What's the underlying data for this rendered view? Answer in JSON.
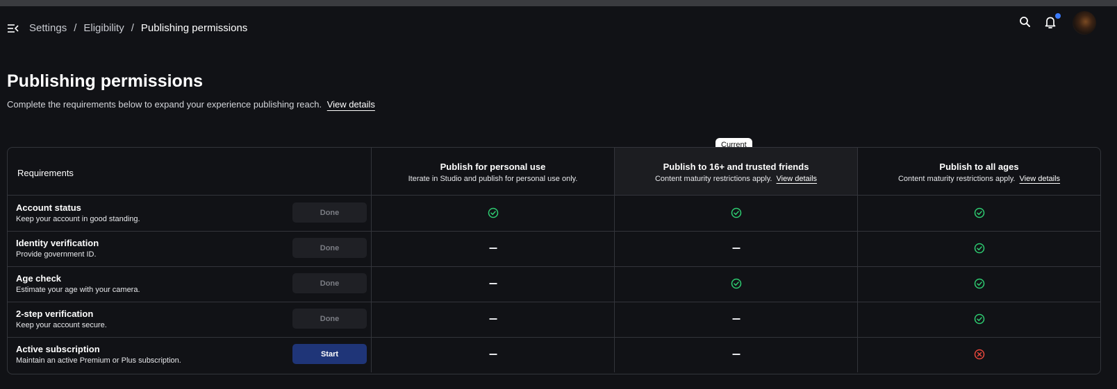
{
  "breadcrumbs": [
    "Settings",
    "Eligibility",
    "Publishing permissions"
  ],
  "page": {
    "title": "Publishing permissions",
    "subtitle": "Complete the requirements below to expand your experience publishing reach.",
    "subtitle_link": "View details"
  },
  "icons": {
    "menu": "menu-collapse-icon",
    "search": "search-icon",
    "bell": "bell-icon",
    "check": "check-circle-icon",
    "cross": "x-circle-icon",
    "dash": "dash-icon"
  },
  "colors": {
    "background": "#111216",
    "check": "#2ecc71",
    "cross": "#e8473b",
    "primary_button": "#1f3578",
    "notification_dot": "#3b7bff"
  },
  "table": {
    "requirements_header": "Requirements",
    "current_badge": "Current",
    "columns": [
      {
        "title": "Publish for personal use",
        "subtitle": "Iterate in Studio and publish for personal use only.",
        "link": ""
      },
      {
        "title": "Publish to 16+ and trusted friends",
        "subtitle": "Content maturity restrictions apply.",
        "link": "View details"
      },
      {
        "title": "Publish to all ages",
        "subtitle": "Content maturity restrictions apply.",
        "link": "View details"
      }
    ],
    "rows": [
      {
        "title": "Account status",
        "description": "Keep your account in good standing.",
        "button": "Done",
        "status": [
          "check",
          "check",
          "check"
        ]
      },
      {
        "title": "Identity verification",
        "description": "Provide government ID.",
        "button": "Done",
        "status": [
          "dash",
          "dash",
          "check"
        ]
      },
      {
        "title": "Age check",
        "description": "Estimate your age with your camera.",
        "button": "Done",
        "status": [
          "dash",
          "check",
          "check"
        ]
      },
      {
        "title": "2-step verification",
        "description": "Keep your account secure.",
        "button": "Done",
        "status": [
          "dash",
          "dash",
          "check"
        ]
      },
      {
        "title": "Active subscription",
        "description": "Maintain an active Premium or Plus subscription.",
        "button": "Start",
        "status": [
          "dash",
          "dash",
          "cross"
        ]
      }
    ]
  }
}
